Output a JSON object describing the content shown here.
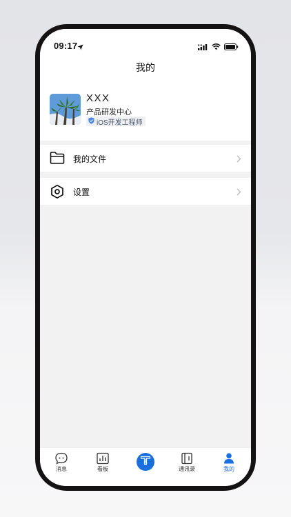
{
  "status_bar": {
    "time": "09:17"
  },
  "header": {
    "title": "我的"
  },
  "profile": {
    "name": "XXX",
    "department": "产品研发中心",
    "role": "iOS开发工程师"
  },
  "menu": [
    {
      "label": "我的文件",
      "icon": "folder-icon"
    },
    {
      "label": "设置",
      "icon": "settings-hexagon-icon"
    }
  ],
  "tabbar": {
    "items": [
      {
        "label": "消息",
        "icon": "message-bubble-icon"
      },
      {
        "label": "看板",
        "icon": "dashboard-chart-icon"
      },
      {
        "label": "",
        "icon": "app-logo-icon"
      },
      {
        "label": "通讯录",
        "icon": "contacts-book-icon"
      },
      {
        "label": "我的",
        "icon": "person-icon"
      }
    ],
    "active": "我的"
  },
  "colors": {
    "accent": "#1a6fe0",
    "background": "#f2f2f3"
  }
}
